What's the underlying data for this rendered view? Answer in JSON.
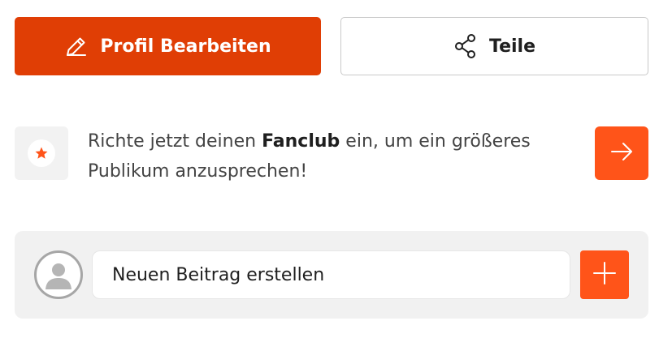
{
  "actions": {
    "edit_profile_label": "Profil Bearbeiten",
    "edit_icon": "pencil-icon",
    "share_label": "Teile",
    "share_icon": "share-icon"
  },
  "fanclub_promo": {
    "icon": "star-icon",
    "text_before": "Richte jetzt deinen ",
    "text_bold": "Fanclub",
    "text_after": " ein, um ein größeres Publikum anzusprechen!",
    "arrow_icon": "arrow-right-icon"
  },
  "composer": {
    "avatar_icon": "user-avatar-icon",
    "placeholder": "Neuen Beitrag erstellen",
    "add_icon": "plus-icon"
  },
  "colors": {
    "primary_button": "#e03e05",
    "accent": "#ff5419",
    "panel_background": "#f1f1f1"
  }
}
